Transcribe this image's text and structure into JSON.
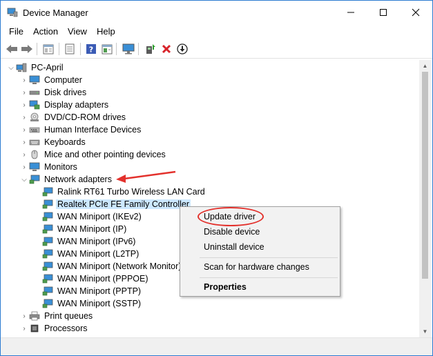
{
  "window": {
    "title": "Device Manager",
    "controls": {
      "minimize": "—",
      "maximize": "☐",
      "close": "✕"
    }
  },
  "menu": [
    "File",
    "Action",
    "View",
    "Help"
  ],
  "toolbar": {
    "buttons": [
      "back-icon",
      "forward-icon",
      "tree-view-icon",
      "properties-icon",
      "help-icon",
      "details-icon",
      "monitor-icon",
      "update-driver-icon",
      "remove-device-icon",
      "download-icon"
    ]
  },
  "tree": {
    "root": "PC-April",
    "categories_before": [
      "Computer",
      "Disk drives",
      "Display adapters",
      "DVD/CD-ROM drives",
      "Human Interface Devices",
      "Keyboards",
      "Mice and other pointing devices",
      "Monitors"
    ],
    "expanded": "Network adapters",
    "network_adapters": [
      "Ralink RT61 Turbo Wireless LAN Card",
      "Realtek PCIe FE Family Controller",
      "WAN Miniport (IKEv2)",
      "WAN Miniport (IP)",
      "WAN Miniport (IPv6)",
      "WAN Miniport (L2TP)",
      "WAN Miniport (Network Monitor)",
      "WAN Miniport (PPPOE)",
      "WAN Miniport (PPTP)",
      "WAN Miniport (SSTP)"
    ],
    "selected": "Realtek PCIe FE Family Controller",
    "categories_after": [
      "Print queues",
      "Processors"
    ]
  },
  "context_menu": {
    "items": [
      "Update driver",
      "Disable device",
      "Uninstall device",
      "Scan for hardware changes",
      "Properties"
    ],
    "highlighted": "Update driver"
  },
  "colors": {
    "accent_border": "#2b7bd1",
    "selection": "#cce8ff",
    "annotation_red": "#e3312c"
  }
}
